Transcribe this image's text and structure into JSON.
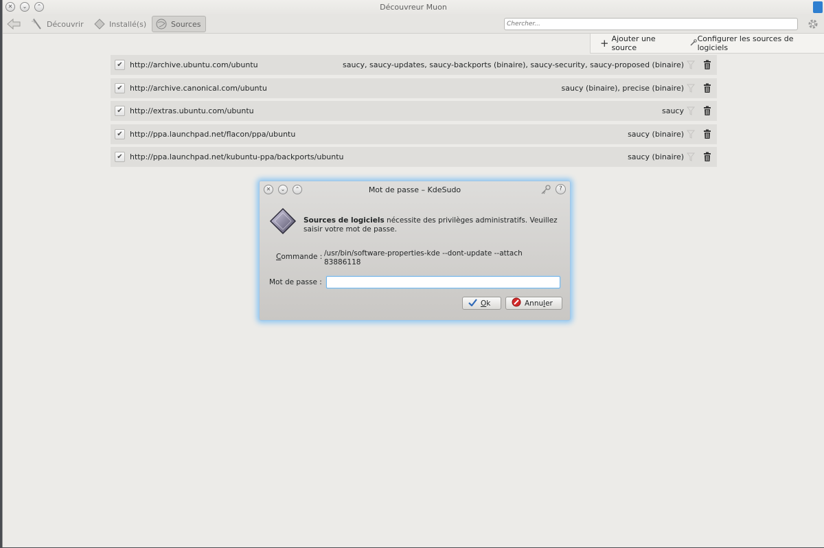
{
  "window": {
    "title": "Découvreur Muon"
  },
  "toolbar": {
    "tabs": [
      {
        "label": "Découvrir"
      },
      {
        "label": "Installé(s)"
      },
      {
        "label": "Sources"
      }
    ],
    "search_placeholder": "Chercher..."
  },
  "source_actions": {
    "add_label": "Ajouter une source",
    "configure_label": "Configurer les sources de logiciels"
  },
  "sources": [
    {
      "url": "http://archive.ubuntu.com/ubuntu",
      "suites": "saucy, saucy-updates, saucy-backports (binaire), saucy-security, saucy-proposed (binaire)"
    },
    {
      "url": "http://archive.canonical.com/ubuntu",
      "suites": "saucy (binaire), precise (binaire)"
    },
    {
      "url": "http://extras.ubuntu.com/ubuntu",
      "suites": "saucy"
    },
    {
      "url": "http://ppa.launchpad.net/flacon/ppa/ubuntu",
      "suites": "saucy (binaire)"
    },
    {
      "url": "http://ppa.launchpad.net/kubuntu-ppa/backports/ubuntu",
      "suites": "saucy (binaire)"
    }
  ],
  "dialog": {
    "title": "Mot de passe – KdeSudo",
    "message_bold": "Sources de logiciels",
    "message_rest": " nécessite des privilèges administratifs. Veuillez saisir votre mot de passe.",
    "command_label_first": "C",
    "command_label_rest": "ommande :",
    "command_value": "/usr/bin/software-properties-kde --dont-update --attach 83886118",
    "password_label": "Mot de passe :",
    "password_value": "",
    "ok_first": "O",
    "ok_rest": "k",
    "cancel_before": "Annu",
    "cancel_underlined": "l",
    "cancel_after": "er"
  }
}
